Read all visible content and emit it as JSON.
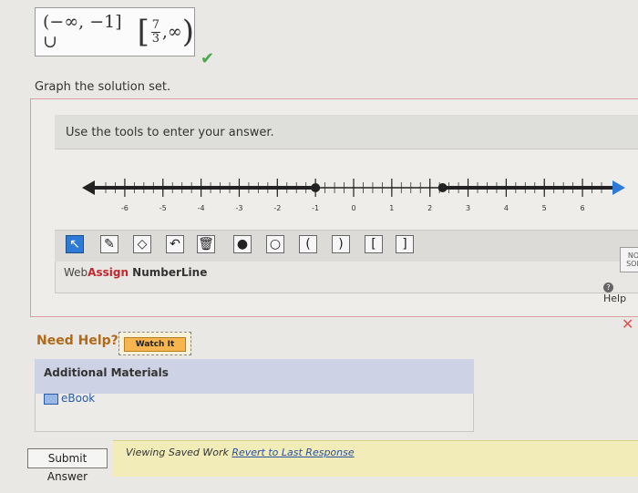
{
  "answer": {
    "left_part": "(−∞, −1] ∪",
    "frac_num": "7",
    "frac_den": "3",
    "open_bracket": "[",
    "tail": ",∞",
    "close_paren": ")",
    "status": "✔"
  },
  "instruction": "Graph the solution set.",
  "tool_panel": {
    "header": "Use the tools to enter your answer.",
    "ticks": [
      "-6",
      "-5",
      "-4",
      "-3",
      "-2",
      "-1",
      "0",
      "1",
      "2",
      "3",
      "4",
      "5",
      "6"
    ],
    "tools": [
      "↖",
      "✎",
      "◇",
      "↶",
      "🗑",
      "●",
      "○",
      "(",
      ")",
      "[",
      "]"
    ],
    "brand_web": "Web",
    "brand_assign": "Assign",
    "brand_tool": " NumberLine"
  },
  "graph_values": {
    "x_min": -6.5,
    "x_max": 6.5,
    "solid_points": [
      -1,
      2.333
    ],
    "shaded": [
      [
        "-inf",
        -1
      ],
      [
        2.333,
        "inf"
      ]
    ]
  },
  "no_solution": "NO SOL",
  "help": "Help",
  "need_help": {
    "label": "Need Help?",
    "watch_label": "Watch It"
  },
  "materials": {
    "header": "Additional Materials",
    "ebook": "eBook"
  },
  "submit_label": "Submit Answer",
  "saved": {
    "prefix": "Viewing Saved Work ",
    "revert": "Revert to Last Response"
  },
  "colors": {
    "accent": "#2d7bd6",
    "check": "#4aa84a",
    "error": "#e05050",
    "brand_red": "#c2272d"
  }
}
